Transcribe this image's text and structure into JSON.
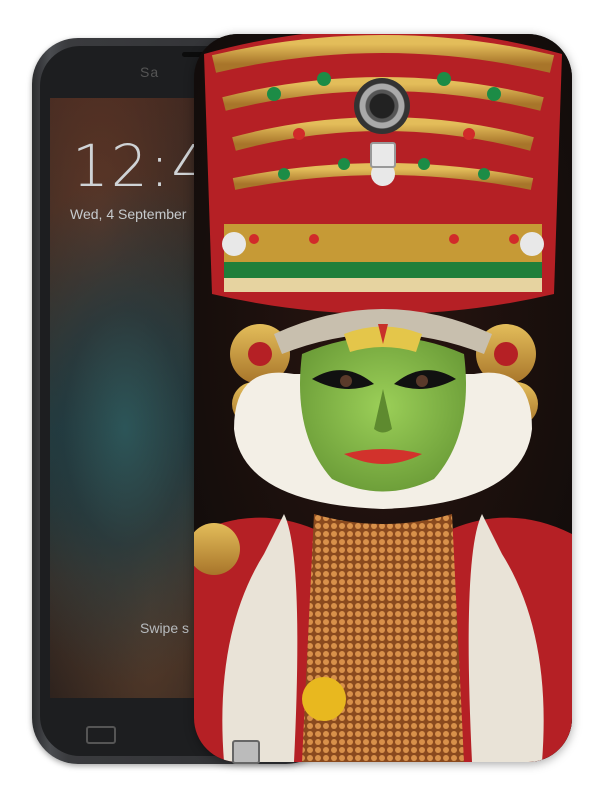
{
  "phone": {
    "brand": "Sa",
    "lock_screen": {
      "time": "12:4",
      "date": "Wed, 4 September",
      "hint": "Swipe s"
    }
  },
  "case_art": {
    "subject": "Kathakali dancer portrait",
    "colors": {
      "face": "#86b84a",
      "crown_gold": "#c69a36",
      "crown_red": "#b52025",
      "collar": "#f3efe6",
      "scarf": "#e9e3d7",
      "necklace": "#c9803e",
      "lip": "#d2322c"
    }
  }
}
